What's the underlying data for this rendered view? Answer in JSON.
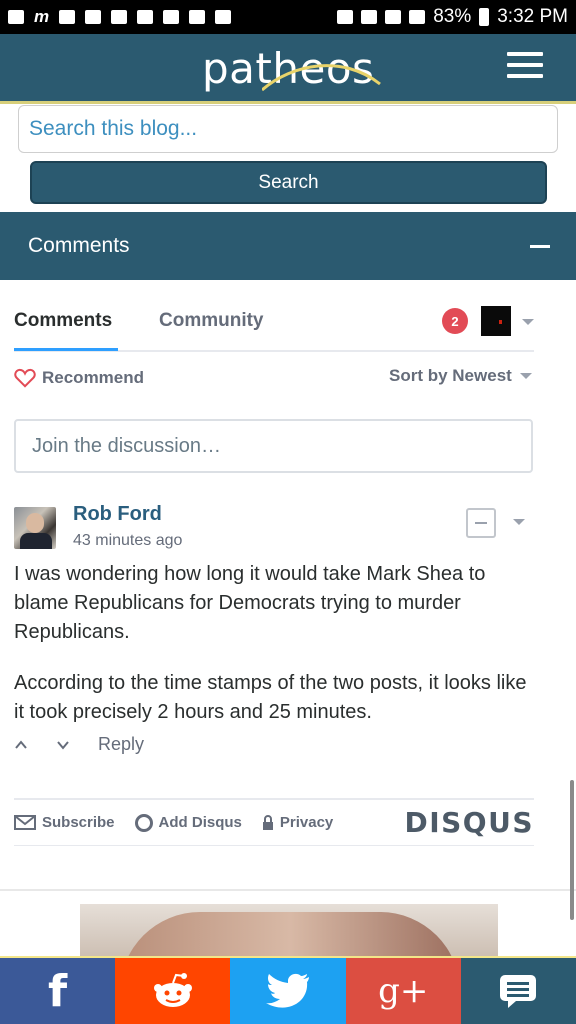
{
  "status_bar": {
    "battery": "83%",
    "time": "3:32 PM"
  },
  "header": {
    "logo_text": "patheos"
  },
  "search": {
    "placeholder": "Search this blog...",
    "button_label": "Search"
  },
  "comments_section": {
    "title": "Comments"
  },
  "disqus": {
    "tabs": [
      "Comments",
      "Community"
    ],
    "notification_count": "2",
    "recommend_label": "Recommend",
    "sort_label": "Sort by Newest",
    "join_placeholder": "Join the discussion…",
    "comment": {
      "author": "Rob Ford",
      "time": "43 minutes ago",
      "paragraphs": [
        "I was wondering how long it would take Mark Shea to blame Republicans for Democrats trying to murder Republicans.",
        "According to the time stamps of the two posts, it looks like it took precisely 2 hours and 25 minutes."
      ],
      "reply_label": "Reply"
    },
    "footer": {
      "subscribe": "Subscribe",
      "add_disqus": "Add Disqus",
      "privacy": "Privacy",
      "brand": "DISQUS"
    }
  },
  "share_bar": {
    "colors": {
      "facebook": "#3b5998",
      "reddit": "#ff4500",
      "twitter": "#1da1f2",
      "google_plus": "#dc4e41",
      "comments": "#2b5a70"
    }
  },
  "colors": {
    "brand": "#2b5a70",
    "link": "#2a5e7e",
    "badge": "#e24b56"
  }
}
